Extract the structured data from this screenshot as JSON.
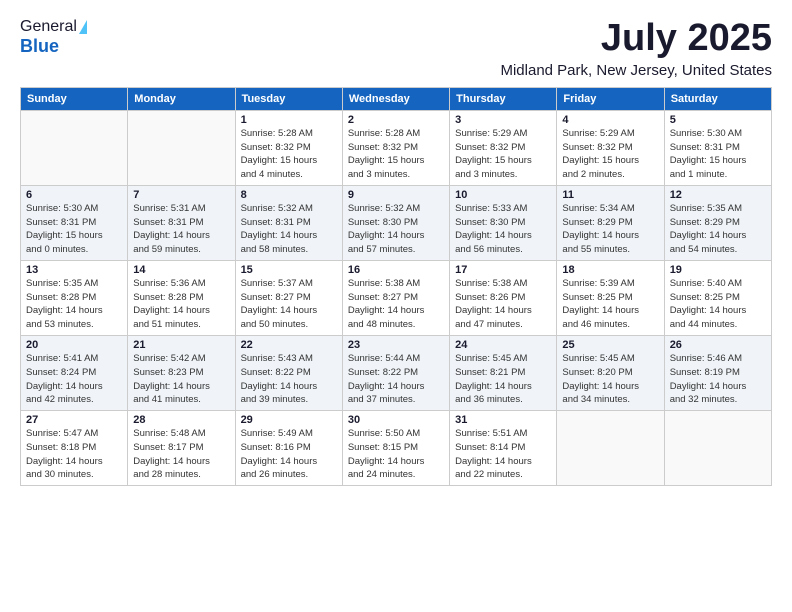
{
  "logo": {
    "line1": "General",
    "line2": "Blue"
  },
  "title": "July 2025",
  "location": "Midland Park, New Jersey, United States",
  "days_of_week": [
    "Sunday",
    "Monday",
    "Tuesday",
    "Wednesday",
    "Thursday",
    "Friday",
    "Saturday"
  ],
  "weeks": [
    [
      {
        "day": "",
        "info": ""
      },
      {
        "day": "",
        "info": ""
      },
      {
        "day": "1",
        "info": "Sunrise: 5:28 AM\nSunset: 8:32 PM\nDaylight: 15 hours\nand 4 minutes."
      },
      {
        "day": "2",
        "info": "Sunrise: 5:28 AM\nSunset: 8:32 PM\nDaylight: 15 hours\nand 3 minutes."
      },
      {
        "day": "3",
        "info": "Sunrise: 5:29 AM\nSunset: 8:32 PM\nDaylight: 15 hours\nand 3 minutes."
      },
      {
        "day": "4",
        "info": "Sunrise: 5:29 AM\nSunset: 8:32 PM\nDaylight: 15 hours\nand 2 minutes."
      },
      {
        "day": "5",
        "info": "Sunrise: 5:30 AM\nSunset: 8:31 PM\nDaylight: 15 hours\nand 1 minute."
      }
    ],
    [
      {
        "day": "6",
        "info": "Sunrise: 5:30 AM\nSunset: 8:31 PM\nDaylight: 15 hours\nand 0 minutes."
      },
      {
        "day": "7",
        "info": "Sunrise: 5:31 AM\nSunset: 8:31 PM\nDaylight: 14 hours\nand 59 minutes."
      },
      {
        "day": "8",
        "info": "Sunrise: 5:32 AM\nSunset: 8:31 PM\nDaylight: 14 hours\nand 58 minutes."
      },
      {
        "day": "9",
        "info": "Sunrise: 5:32 AM\nSunset: 8:30 PM\nDaylight: 14 hours\nand 57 minutes."
      },
      {
        "day": "10",
        "info": "Sunrise: 5:33 AM\nSunset: 8:30 PM\nDaylight: 14 hours\nand 56 minutes."
      },
      {
        "day": "11",
        "info": "Sunrise: 5:34 AM\nSunset: 8:29 PM\nDaylight: 14 hours\nand 55 minutes."
      },
      {
        "day": "12",
        "info": "Sunrise: 5:35 AM\nSunset: 8:29 PM\nDaylight: 14 hours\nand 54 minutes."
      }
    ],
    [
      {
        "day": "13",
        "info": "Sunrise: 5:35 AM\nSunset: 8:28 PM\nDaylight: 14 hours\nand 53 minutes."
      },
      {
        "day": "14",
        "info": "Sunrise: 5:36 AM\nSunset: 8:28 PM\nDaylight: 14 hours\nand 51 minutes."
      },
      {
        "day": "15",
        "info": "Sunrise: 5:37 AM\nSunset: 8:27 PM\nDaylight: 14 hours\nand 50 minutes."
      },
      {
        "day": "16",
        "info": "Sunrise: 5:38 AM\nSunset: 8:27 PM\nDaylight: 14 hours\nand 48 minutes."
      },
      {
        "day": "17",
        "info": "Sunrise: 5:38 AM\nSunset: 8:26 PM\nDaylight: 14 hours\nand 47 minutes."
      },
      {
        "day": "18",
        "info": "Sunrise: 5:39 AM\nSunset: 8:25 PM\nDaylight: 14 hours\nand 46 minutes."
      },
      {
        "day": "19",
        "info": "Sunrise: 5:40 AM\nSunset: 8:25 PM\nDaylight: 14 hours\nand 44 minutes."
      }
    ],
    [
      {
        "day": "20",
        "info": "Sunrise: 5:41 AM\nSunset: 8:24 PM\nDaylight: 14 hours\nand 42 minutes."
      },
      {
        "day": "21",
        "info": "Sunrise: 5:42 AM\nSunset: 8:23 PM\nDaylight: 14 hours\nand 41 minutes."
      },
      {
        "day": "22",
        "info": "Sunrise: 5:43 AM\nSunset: 8:22 PM\nDaylight: 14 hours\nand 39 minutes."
      },
      {
        "day": "23",
        "info": "Sunrise: 5:44 AM\nSunset: 8:22 PM\nDaylight: 14 hours\nand 37 minutes."
      },
      {
        "day": "24",
        "info": "Sunrise: 5:45 AM\nSunset: 8:21 PM\nDaylight: 14 hours\nand 36 minutes."
      },
      {
        "day": "25",
        "info": "Sunrise: 5:45 AM\nSunset: 8:20 PM\nDaylight: 14 hours\nand 34 minutes."
      },
      {
        "day": "26",
        "info": "Sunrise: 5:46 AM\nSunset: 8:19 PM\nDaylight: 14 hours\nand 32 minutes."
      }
    ],
    [
      {
        "day": "27",
        "info": "Sunrise: 5:47 AM\nSunset: 8:18 PM\nDaylight: 14 hours\nand 30 minutes."
      },
      {
        "day": "28",
        "info": "Sunrise: 5:48 AM\nSunset: 8:17 PM\nDaylight: 14 hours\nand 28 minutes."
      },
      {
        "day": "29",
        "info": "Sunrise: 5:49 AM\nSunset: 8:16 PM\nDaylight: 14 hours\nand 26 minutes."
      },
      {
        "day": "30",
        "info": "Sunrise: 5:50 AM\nSunset: 8:15 PM\nDaylight: 14 hours\nand 24 minutes."
      },
      {
        "day": "31",
        "info": "Sunrise: 5:51 AM\nSunset: 8:14 PM\nDaylight: 14 hours\nand 22 minutes."
      },
      {
        "day": "",
        "info": ""
      },
      {
        "day": "",
        "info": ""
      }
    ]
  ]
}
